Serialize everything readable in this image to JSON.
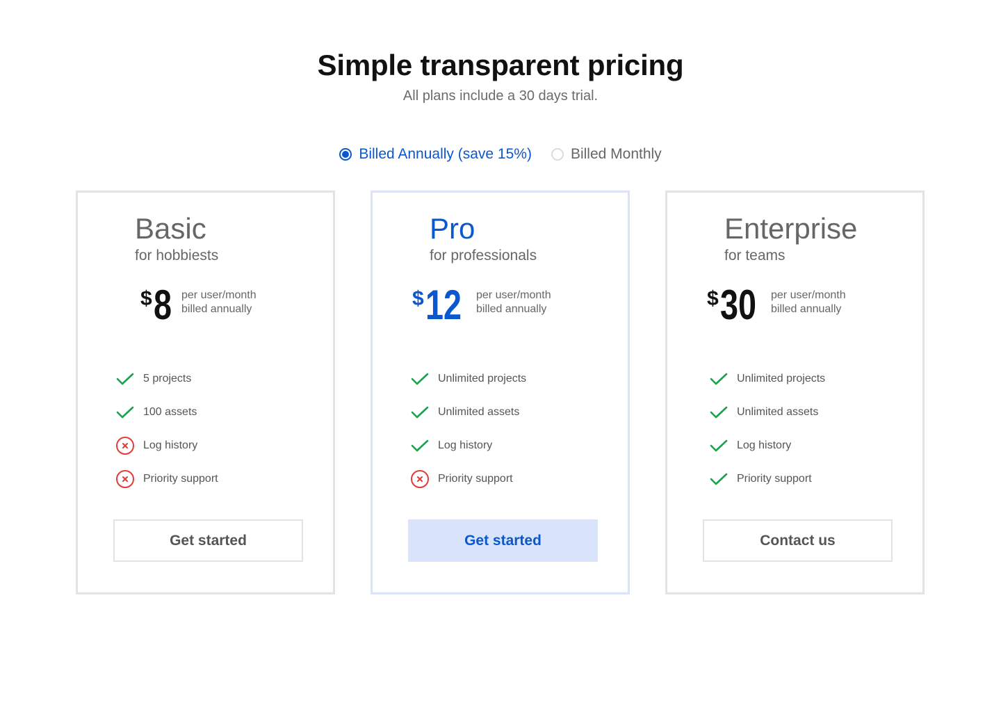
{
  "header": {
    "title": "Simple transparent pricing",
    "subtitle": "All plans include a 30 days trial."
  },
  "billing": {
    "annual_label": "Billed Annually (save 15%)",
    "monthly_label": "Billed Monthly",
    "selected": "annual"
  },
  "colors": {
    "accent": "#0b57d0",
    "accent_light": "#d9e4fb",
    "check": "#17a34a",
    "cross": "#e53935"
  },
  "plans": [
    {
      "name": "Basic",
      "tagline": "for hobbiests",
      "currency": "$",
      "price": "8",
      "price_line1": "per user/month",
      "price_line2": "billed annually",
      "features": [
        {
          "label": "5 projects",
          "included": true
        },
        {
          "label": "100 assets",
          "included": true
        },
        {
          "label": "Log history",
          "included": false
        },
        {
          "label": "Priority support",
          "included": false
        }
      ],
      "cta": "Get started"
    },
    {
      "name": "Pro",
      "tagline": "for professionals",
      "currency": "$",
      "price": "12",
      "price_line1": "per user/month",
      "price_line2": "billed annually",
      "features": [
        {
          "label": "Unlimited projects",
          "included": true
        },
        {
          "label": "Unlimited assets",
          "included": true
        },
        {
          "label": "Log history",
          "included": true
        },
        {
          "label": "Priority support",
          "included": false
        }
      ],
      "cta": "Get started"
    },
    {
      "name": "Enterprise",
      "tagline": "for teams",
      "currency": "$",
      "price": "30",
      "price_line1": "per user/month",
      "price_line2": "billed annually",
      "features": [
        {
          "label": "Unlimited projects",
          "included": true
        },
        {
          "label": "Unlimited assets",
          "included": true
        },
        {
          "label": "Log history",
          "included": true
        },
        {
          "label": "Priority support",
          "included": true
        }
      ],
      "cta": "Contact us"
    }
  ]
}
